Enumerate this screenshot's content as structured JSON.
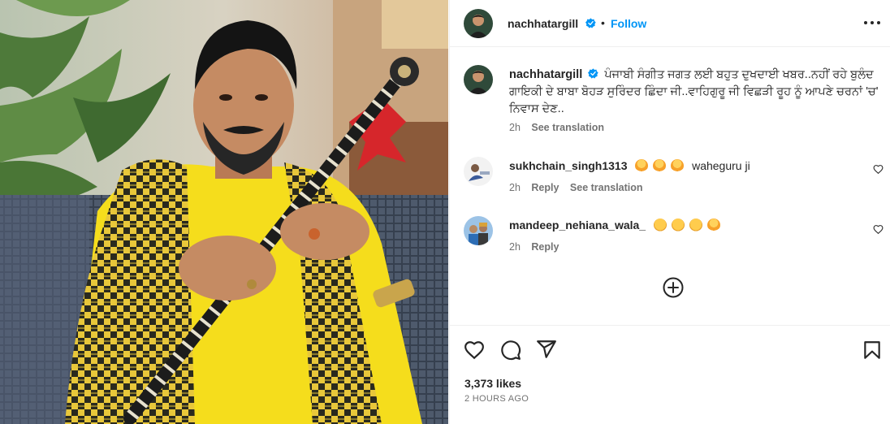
{
  "post": {
    "username": "nachhatargill",
    "follow_label": "Follow",
    "dot": "•",
    "caption": {
      "username": "nachhatargill",
      "text": "ਪੰਜਾਬੀ ਸੰਗੀਤ ਜਗਤ ਲਈ ਬਹੁਤ ਦੁਖਦਾਈ ਖਬਰ..ਨਹੀਂ ਰਹੇ ਬੁਲੰਦ ਗਾਇਕੀ ਦੇ ਬਾਬਾ ਬੋਹੜ ਸੁਰਿੰਦਰ ਛਿੰਦਾ ਜੀ..ਵਾਹਿਗੁਰੂ ਜੀ ਵਿਛੜੀ ਰੂਹ ਨੂੰ ਆਪਣੇ ਚਰਨਾਂ 'ਚ' ਨਿਵਾਸ ਦੇਣ..",
      "age": "2h",
      "see_translation": "See translation"
    },
    "comments": [
      {
        "username": "sukhchain_singh1313",
        "emojis": [
          "pray",
          "pray",
          "pray"
        ],
        "text": "waheguru ji",
        "age": "2h",
        "reply": "Reply",
        "see_translation": "See translation"
      },
      {
        "username": "mandeep_nehiana_wala_",
        "emojis": [
          "sad",
          "sad",
          "sad",
          "pray"
        ],
        "text": "",
        "age": "2h",
        "reply": "Reply"
      }
    ],
    "likes": "3,373 likes",
    "posted": "2 HOURS AGO"
  },
  "icons": {
    "verified": "verified-badge-icon",
    "more": "more-options-icon",
    "comment_like": "heart-icon",
    "load_more": "plus-circle-icon",
    "like": "heart-icon",
    "comment": "comment-icon",
    "share": "send-icon",
    "save": "bookmark-icon"
  },
  "colors": {
    "accent": "#0095f6",
    "text": "#262626",
    "muted": "#737373",
    "divider": "#efefef"
  }
}
